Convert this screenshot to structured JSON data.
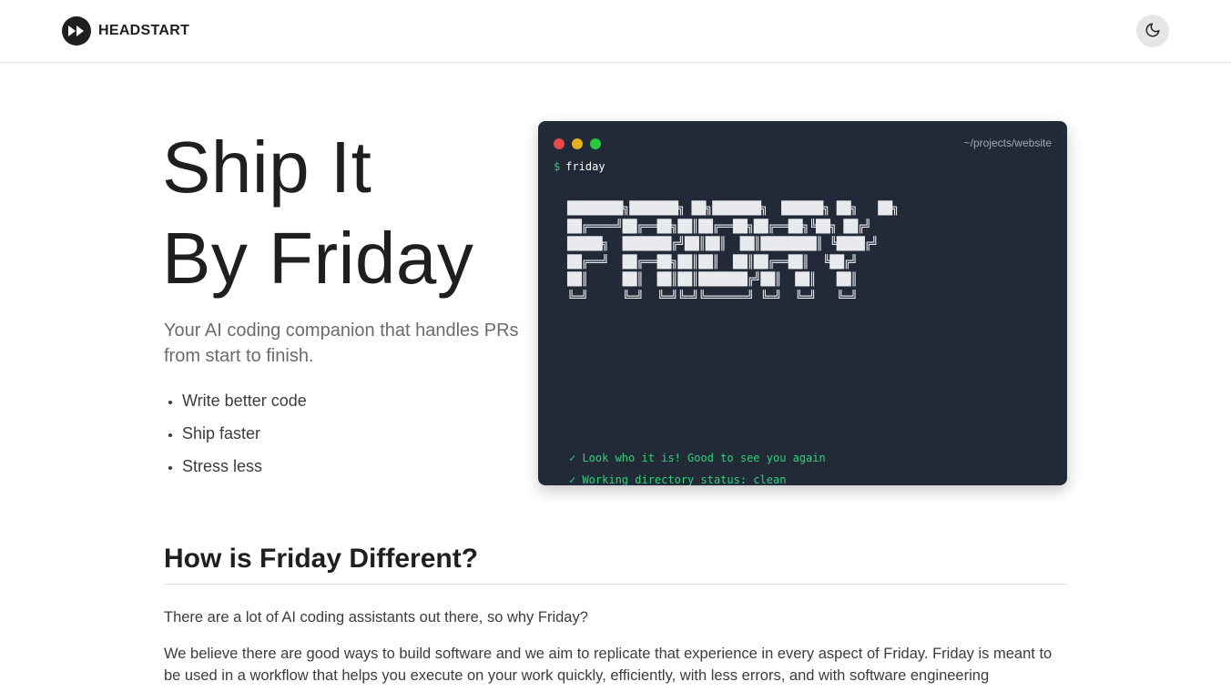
{
  "header": {
    "brand_name": "HEADSTART",
    "logo_icon": "fast-forward-icon",
    "theme_toggle_icon": "moon-icon"
  },
  "hero": {
    "title_line1": "Ship It",
    "title_line2": "By Friday",
    "subtitle": "Your AI coding companion that handles PRs from start to finish.",
    "bullets": [
      "Write better code",
      "Ship faster",
      "Stress less"
    ]
  },
  "terminal": {
    "path": "~/projects/website",
    "prompt_symbol": "$",
    "command": "friday",
    "ascii_art": "████████╗███████╗ ██╗███████╗  ██████╗ ██╗   ██╗\n██╔════╝██╔══██╗██║██╔══██╗██╔══██╗╚██╗ ██╔╝\n█████╗  ███████╔╝██║██║  ██║████████║ ╚████╔╝\n██╔══╝  ██╔══██╗██║██║  ██║██╔══██║  ╚██╔╝\n██║     ██║  ██║██║███████╔╝██║  ██║   ██║\n╚═╝     ╚═╝  ╚═╝╚═╝╚══════╝ ╚═╝  ╚═╝   ╚═╝",
    "status_lines": [
      "✓ Look who it is! Good to see you again",
      "✓ Working directory status: clean"
    ],
    "colors": {
      "background": "#222a38",
      "success": "#31d07a",
      "dot_red": "#e54b4b",
      "dot_yellow": "#e5b020",
      "dot_green": "#28c840"
    }
  },
  "section": {
    "title": "How is Friday Different?",
    "paragraph1": "There are a lot of AI coding assistants out there, so why Friday?",
    "paragraph2": "We believe there are good ways to build software and we aim to replicate that experience in every aspect of Friday. Friday is meant to be used in a workflow that helps you execute on your work quickly, efficiently, with less errors, and with software engineering"
  }
}
